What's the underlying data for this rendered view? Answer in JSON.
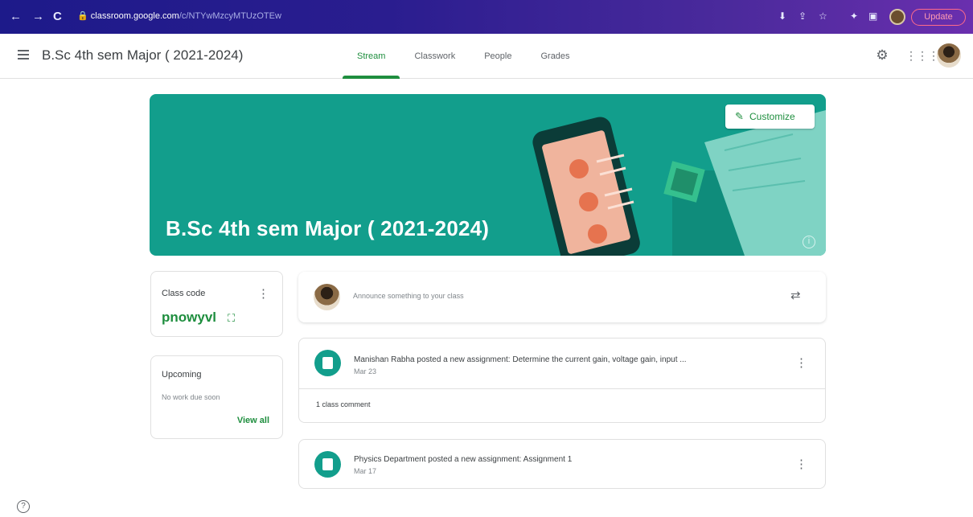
{
  "browser": {
    "back": "←",
    "forward": "→",
    "reload": "C",
    "url_host": "classroom.google.com",
    "url_path": "/c/NTYwMzcyMTUzOTEw",
    "update_label": "Update"
  },
  "header": {
    "class_title": "B.Sc 4th sem Major ( 2021-2024)",
    "tabs": [
      {
        "label": "Stream"
      },
      {
        "label": "Classwork"
      },
      {
        "label": "People"
      },
      {
        "label": "Grades"
      }
    ]
  },
  "banner": {
    "title": "B.Sc 4th sem Major ( 2021-2024)",
    "customize_label": "Customize",
    "color": "#129e8c"
  },
  "class_code": {
    "label": "Class code",
    "value": "pnowyvl"
  },
  "upcoming": {
    "title": "Upcoming",
    "empty_text": "No work due soon",
    "view_all": "View all"
  },
  "announce": {
    "placeholder": "Announce something to your class"
  },
  "posts": [
    {
      "title": "Manishan Rabha posted a new assignment: Determine the current gain, voltage gain, input ...",
      "date": "Mar 23",
      "comment": "1 class comment"
    },
    {
      "title": "Physics Department posted a new assignment: Assignment 1",
      "date": "Mar 17"
    }
  ],
  "colors": {
    "accent": "#1e8e3e",
    "banner": "#129e8c"
  }
}
